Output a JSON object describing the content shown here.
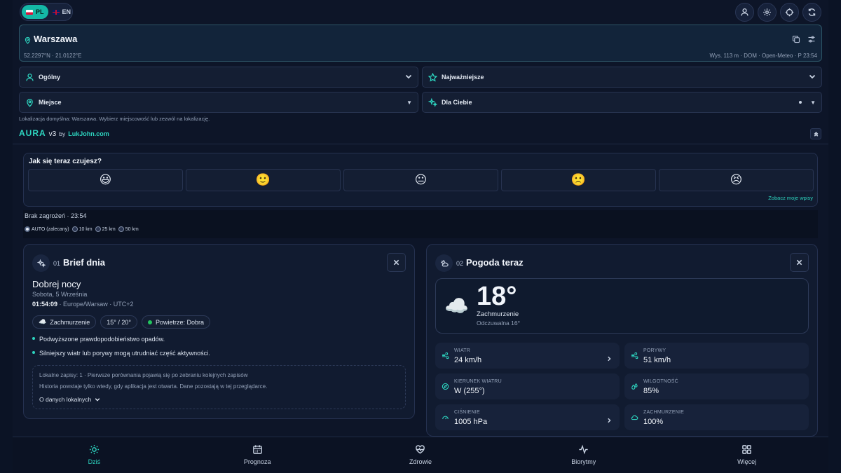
{
  "lang": {
    "pl": "PL",
    "en": "EN",
    "active": "PL"
  },
  "location": {
    "city": "Warszawa",
    "coords": "52.2297°N · 21.0122°E",
    "meta": "Wys. 113 m · DOM · Open-Meteo · P 23:54"
  },
  "selects": {
    "profile": "Ogólny",
    "priority": "Najważniejsze",
    "place": "Miejsce",
    "forYou": "Dla Ciebie"
  },
  "hint": "Lokalizacja domyślna: Warszawa. Wybierz miejscowość lub zezwól na lokalizację.",
  "brand": {
    "name": "AURA",
    "version": "v3",
    "by": "by",
    "link": "LukJohn.com"
  },
  "mood": {
    "question": "Jak się teraz czujesz?",
    "faces": [
      "😃",
      "🙂",
      "😐",
      "🙁",
      "😣"
    ],
    "see_entries": "Zobacz moje wpisy"
  },
  "risk": {
    "status": "Brak zagrożeń · 23:54",
    "radius_options": [
      "AUTO (zalecany)",
      "10 km",
      "25 km",
      "50 km"
    ],
    "selected": "AUTO (zalecany)"
  },
  "brief": {
    "num": "01",
    "title": "Brief dnia",
    "greeting": "Dobrej nocy",
    "date": "Sobota, 5 Września",
    "time": "01:54:09",
    "timezone": " · Europe/Warsaw · UTC+2",
    "chips": {
      "sky": "Zachmurzenie",
      "temps": "15° / 20°",
      "air": "Powietrze: Dobra"
    },
    "bullets": [
      "Podwyższone prawdopodobieństwo opadów.",
      "Silniejszy wiatr lub porywy mogą utrudniać część aktywności."
    ],
    "local": {
      "line1": "Lokalne zapisy: 1 · Pierwsze porównania pojawią się po zebraniu kolejnych zapisów",
      "line2": "Historia powstaje tylko wtedy, gdy aplikacja jest otwarta. Dane pozostają w tej przeglądarce.",
      "more": "O danych lokalnych"
    }
  },
  "weather": {
    "num": "02",
    "title": "Pogoda teraz",
    "temp": "18°",
    "condition": "Zachmurzenie",
    "feels": "Odczuwalna 16°",
    "tiles": {
      "wind": {
        "label": "WIATR",
        "value": "24 km/h"
      },
      "gusts": {
        "label": "PORYWY",
        "value": "51 km/h"
      },
      "direction": {
        "label": "KIERUNEK WIATRU",
        "value": "W (255°)"
      },
      "humidity": {
        "label": "WILGOTNOŚĆ",
        "value": "85%"
      },
      "pressure": {
        "label": "CIŚNIENIE",
        "value": "1005 hPa"
      },
      "clouds": {
        "label": "ZACHMURZENIE",
        "value": "100%"
      }
    }
  },
  "nav": {
    "today": "Dziś",
    "forecast": "Prognoza",
    "health": "Zdrowie",
    "biorhythm": "Biorytmy",
    "more": "Więcej"
  }
}
